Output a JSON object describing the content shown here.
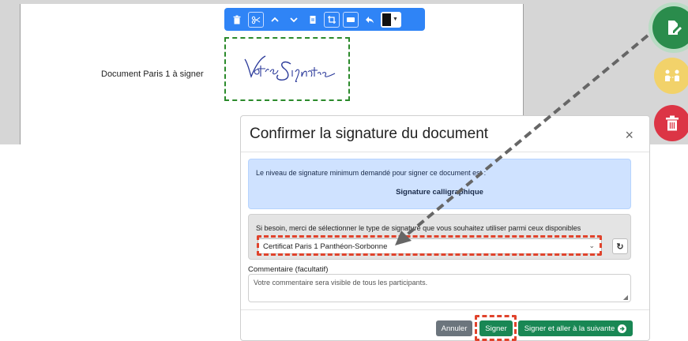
{
  "document": {
    "text": "Document Paris 1 à signer"
  },
  "toolbar": {
    "tools": [
      "trash-icon",
      "scissors-icon",
      "chevron-up-icon",
      "chevron-down-icon",
      "file-icon",
      "crop-icon",
      "badge-icon",
      "undo-icon",
      "color-picker"
    ]
  },
  "signature": {
    "image_text": "Votre Signature"
  },
  "side_actions": [
    "sign-icon",
    "people-icon",
    "trash-icon"
  ],
  "modal": {
    "title": "Confirmer la signature du document",
    "close_symbol": "×",
    "info": {
      "line1": "Le niveau de signature minimum demandé pour signer ce document est :",
      "line2": "Signature calligraphique"
    },
    "select_section": {
      "label": "Si besoin, merci de sélectionner le type de signature que vous souhaitez utiliser parmi ceux disponibles",
      "selected": "Certificat Paris 1 Panthéon-Sorbonne",
      "chevron": "⌄",
      "refresh_symbol": "↻"
    },
    "comment": {
      "label": "Commentaire (facultatif)",
      "placeholder": "Votre commentaire sera visible de tous les participants."
    },
    "buttons": {
      "cancel": "Annuler",
      "sign": "Signer",
      "sign_next": "Signer et aller à la suivante"
    }
  },
  "colors": {
    "toolbar": "#2f84f6",
    "success": "#198754",
    "secondary": "#6c757d",
    "danger": "#dc3545",
    "warning": "#f2d26a",
    "info_bg": "#cfe2ff",
    "highlight": "#e0432c"
  }
}
